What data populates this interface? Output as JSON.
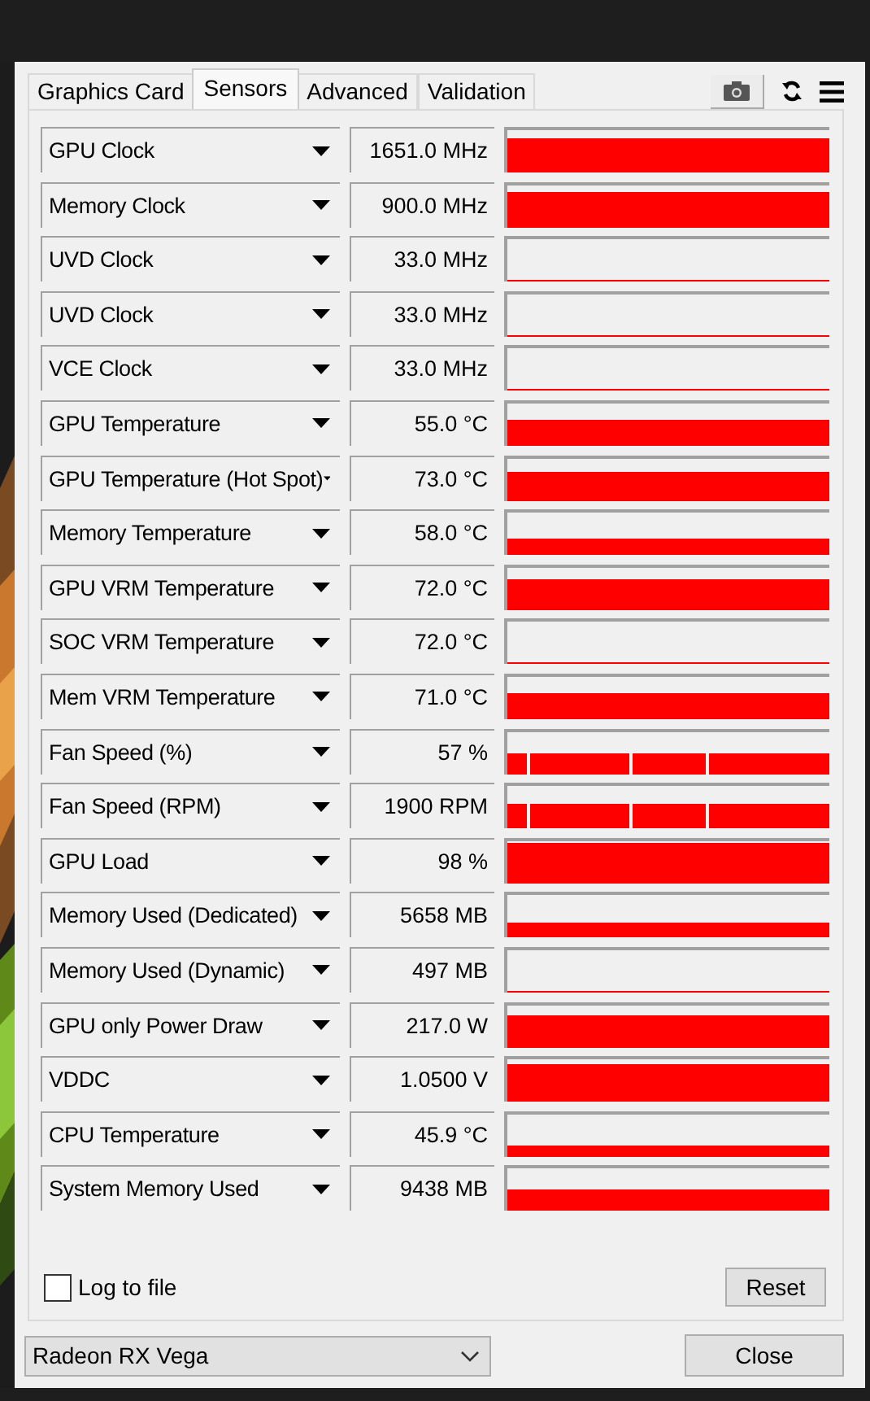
{
  "tabs": [
    {
      "label": "Graphics Card",
      "selected": false
    },
    {
      "label": "Sensors",
      "selected": true
    },
    {
      "label": "Advanced",
      "selected": false
    },
    {
      "label": "Validation",
      "selected": false
    }
  ],
  "sensors": [
    {
      "name": "GPU Clock",
      "value": "1651.0 MHz"
    },
    {
      "name": "Memory Clock",
      "value": "900.0 MHz"
    },
    {
      "name": "UVD Clock",
      "value": "33.0 MHz"
    },
    {
      "name": "UVD Clock",
      "value": "33.0 MHz"
    },
    {
      "name": "VCE Clock",
      "value": "33.0 MHz"
    },
    {
      "name": "GPU Temperature",
      "value": "55.0 °C"
    },
    {
      "name": "GPU Temperature (Hot Spot)",
      "value": "73.0 °C"
    },
    {
      "name": "Memory Temperature",
      "value": "58.0 °C"
    },
    {
      "name": "GPU VRM Temperature",
      "value": "72.0 °C"
    },
    {
      "name": "SOC VRM Temperature",
      "value": "72.0 °C"
    },
    {
      "name": "Mem VRM Temperature",
      "value": "71.0 °C"
    },
    {
      "name": "Fan Speed (%)",
      "value": "57 %"
    },
    {
      "name": "Fan Speed (RPM)",
      "value": "1900 RPM"
    },
    {
      "name": "GPU Load",
      "value": "98 %"
    },
    {
      "name": "Memory Used (Dedicated)",
      "value": "5658 MB"
    },
    {
      "name": "Memory Used (Dynamic)",
      "value": "497 MB"
    },
    {
      "name": "GPU only Power Draw",
      "value": "217.0 W"
    },
    {
      "name": "VDDC",
      "value": "1.0500 V"
    },
    {
      "name": "CPU Temperature",
      "value": "45.9 °C"
    },
    {
      "name": "System Memory Used",
      "value": "9438 MB"
    }
  ],
  "log_to_file": {
    "label": "Log to file",
    "checked": false
  },
  "reset_button": "Reset",
  "gpu_select": {
    "value": "Radeon RX Vega"
  },
  "close_button": "Close"
}
